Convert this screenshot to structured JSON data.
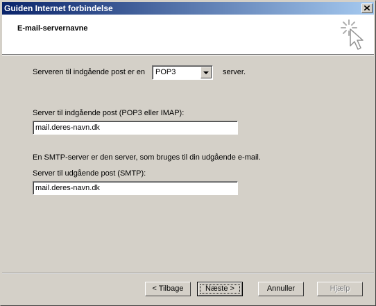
{
  "window": {
    "title": "Guiden Internet forbindelse",
    "close_symbol": "×"
  },
  "header": {
    "title": "E-mail-servernavne",
    "icon": "wizard-cursor-icon"
  },
  "form": {
    "incoming_type_prefix": "Serveren til indgående post er en",
    "incoming_type_value": "POP3",
    "incoming_type_suffix": "server.",
    "incoming_label": "Server til indgående post (POP3 eller IMAP):",
    "incoming_value": "mail.deres-navn.dk",
    "smtp_info": "En SMTP-server er den server, som bruges til din udgående e-mail.",
    "outgoing_label": "Server til udgående post (SMTP):",
    "outgoing_value": "mail.deres-navn.dk"
  },
  "buttons": {
    "back": "< Tilbage",
    "next": "Næste >",
    "cancel": "Annuller",
    "help": "Hjælp"
  }
}
